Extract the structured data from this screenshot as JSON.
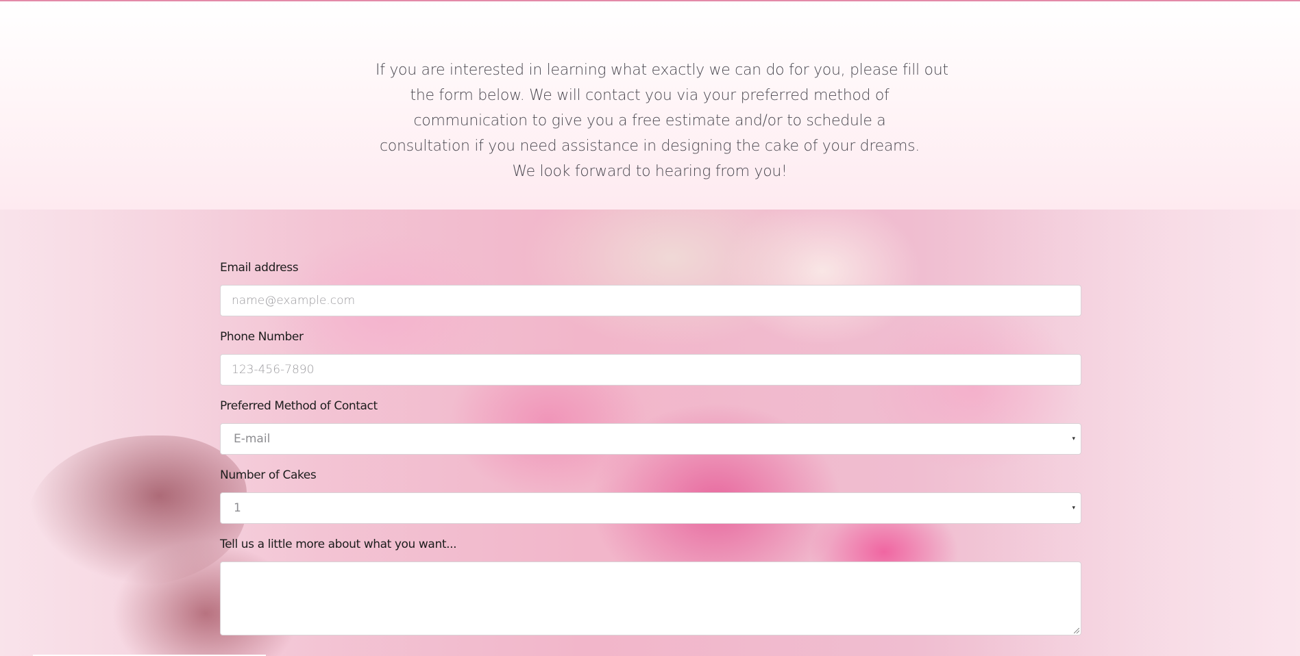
{
  "intro": {
    "lines": [
      "If you are interested in learning what exactly we can do for you, please fill out",
      "the form below. We will contact you via your preferred method of",
      "communication to give you a free estimate and/or to schedule a",
      "consultation if you need assistance in designing the cake of your dreams.",
      "We look forward to hearing from you!"
    ]
  },
  "form": {
    "email": {
      "label": "Email address",
      "placeholder": "name@example.com"
    },
    "phone": {
      "label": "Phone Number",
      "placeholder": "123-456-7890"
    },
    "contact_method": {
      "label": "Preferred Method of Contact",
      "value": "E-mail",
      "chevron": "▾"
    },
    "cake_count": {
      "label": "Number of Cakes",
      "value": "1",
      "chevron": "▾"
    },
    "details": {
      "label": "Tell us a little more about what you want...",
      "value": ""
    }
  },
  "colors": {
    "top_border": "#e38aa8",
    "label_text": "#1c1c1c",
    "intro_text": "#4a4850",
    "background_theme": "pink roses"
  }
}
